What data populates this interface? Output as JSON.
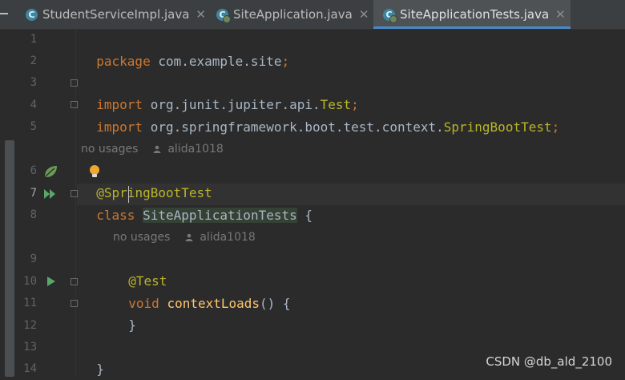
{
  "tabs": [
    {
      "label": "StudentServiceImpl.java",
      "icon": "c-class-icon"
    },
    {
      "label": "SiteApplication.java",
      "icon": "spring-class-icon"
    },
    {
      "label": "SiteApplicationTests.java",
      "icon": "spring-test-class-icon",
      "active": true
    }
  ],
  "lines": {
    "n1": "1",
    "n2": "2",
    "n3": "3",
    "n4": "4",
    "n5": "5",
    "n6": "6",
    "n7": "7",
    "n8": "8",
    "n9": "9",
    "n10": "10",
    "n11": "11",
    "n12": "12",
    "n13": "13",
    "n14": "14"
  },
  "code": {
    "l1_kw": "package",
    "l1_rest": " com.example.site",
    "l1_semi": ";",
    "l3_kw": "import",
    "l3_pkg": " org.junit.jupiter.api.",
    "l3_cls": "Test",
    "l3_semi": ";",
    "l4_kw": "import",
    "l4_pkg": " org.springframework.boot.test.context.",
    "l4_cls": "SpringBootTest",
    "l4_semi": ";",
    "l6_at": "@",
    "l6_ann": "SpringBootTest",
    "l7_kw": "class",
    "l7_name": "SiteApplicationTests",
    "l7_brace": " {",
    "l9_ann": "@Test",
    "l10_kw": "void",
    "l10_fn": "contextLoads",
    "l10_rest": "() {",
    "l11": "}",
    "l13": "}"
  },
  "hints": {
    "usages_1": "no usages",
    "author_1": "alida1018",
    "usages_2": "no usages",
    "author_2": "alida1018"
  },
  "watermark": "CSDN @db_ald_2100",
  "colors": {
    "background": "#2b2b2b",
    "keyword": "#cc7832",
    "annotation": "#bbb529",
    "function": "#ffc66d",
    "accent": "#4a88c7"
  }
}
